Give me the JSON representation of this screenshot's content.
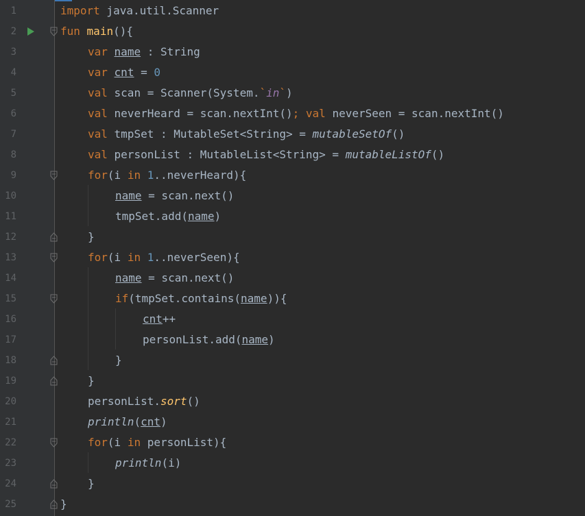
{
  "editor": {
    "colors": {
      "background": "#2b2b2b",
      "gutter": "#313335",
      "line_number": "#606366",
      "default": "#a9b7c6",
      "keyword": "#cc7832",
      "function": "#ffc66d",
      "number": "#6897bb",
      "purple": "#9876aa",
      "run_icon": "#499c54"
    },
    "line_numbers": [
      "1",
      "2",
      "3",
      "4",
      "5",
      "6",
      "7",
      "8",
      "9",
      "10",
      "11",
      "12",
      "13",
      "14",
      "15",
      "16",
      "17",
      "18",
      "19",
      "20",
      "21",
      "22",
      "23",
      "24",
      "25"
    ],
    "run_icon": "run-arrow-icon",
    "fold_icon": "fold-marker-icon",
    "code": {
      "l1": {
        "kw": "import",
        "rest": " java.util.Scanner"
      },
      "l2": {
        "kw": "fun",
        "fn": "main",
        "rest": "(){"
      },
      "l3": {
        "kw": "var",
        "sp": " ",
        "var": "name",
        "rest": " : String"
      },
      "l4": {
        "kw": "var",
        "sp": " ",
        "var": "cnt",
        "eq": " = ",
        "num": "0"
      },
      "l5": {
        "kw": "val",
        "a": " scan = Scanner(System.",
        "b": "`",
        "c": "in",
        "d": "`",
        "e": ")"
      },
      "l6": {
        "kw": "val",
        "a": " neverHeard = scan.nextInt()",
        "semi": ";",
        "sp": " ",
        "kw2": "val",
        "b": " neverSeen = scan.nextInt()"
      },
      "l7": {
        "kw": "val",
        "a": " tmpSet : MutableSet<String> = ",
        "fn": "mutableSetOf",
        "b": "()"
      },
      "l8": {
        "kw": "val",
        "a": " personList : MutableList<String> = ",
        "fn": "mutableListOf",
        "b": "()"
      },
      "l9": {
        "kw": "for",
        "a": "(i ",
        "kw2": "in",
        "sp": " ",
        "num": "1",
        "b": "..neverHeard){"
      },
      "l10": {
        "var": "name",
        "a": " = scan.next()"
      },
      "l11": {
        "a": "tmpSet.add(",
        "var": "name",
        "b": ")"
      },
      "l12": {
        "a": "}"
      },
      "l13": {
        "kw": "for",
        "a": "(i ",
        "kw2": "in",
        "sp": " ",
        "num": "1",
        "b": "..neverSeen){"
      },
      "l14": {
        "var": "name",
        "a": " = scan.next()"
      },
      "l15": {
        "kw": "if",
        "a": "(tmpSet.contains(",
        "var": "name",
        "b": ")){"
      },
      "l16": {
        "var": "cnt",
        "a": "++"
      },
      "l17": {
        "a": "personList.add(",
        "var": "name",
        "b": ")"
      },
      "l18": {
        "a": "}"
      },
      "l19": {
        "a": "}"
      },
      "l20": {
        "a": "personList.",
        "fn": "sort",
        "b": "()"
      },
      "l21": {
        "fn": "println",
        "a": "(",
        "var": "cnt",
        "b": ")"
      },
      "l22": {
        "kw": "for",
        "a": "(i ",
        "kw2": "in",
        "b": " personList){"
      },
      "l23": {
        "fn": "println",
        "a": "(i)"
      },
      "l24": {
        "a": "}"
      },
      "l25": {
        "a": "}"
      }
    }
  }
}
